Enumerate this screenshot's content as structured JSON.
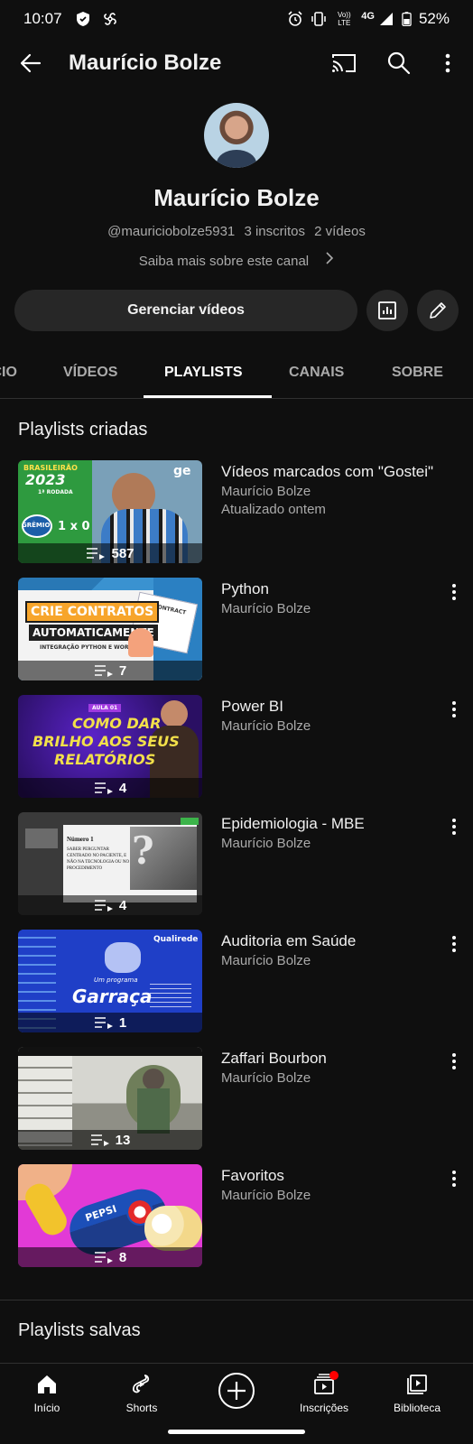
{
  "status_bar": {
    "time": "10:07",
    "network_label": "4G",
    "volte_label": "Vo)) LTE",
    "battery": "52%"
  },
  "app_bar": {
    "title": "Maurício Bolze"
  },
  "channel": {
    "name": "Maurício Bolze",
    "handle": "@mauriciobolze5931",
    "subscribers": "3 inscritos",
    "videos": "2 vídeos",
    "more_about": "Saiba mais sobre este canal",
    "manage_button": "Gerenciar vídeos"
  },
  "tabs": [
    {
      "label": "ÍCIO"
    },
    {
      "label": "VÍDEOS"
    },
    {
      "label": "PLAYLISTS"
    },
    {
      "label": "CANAIS"
    },
    {
      "label": "SOBRE"
    }
  ],
  "sections": {
    "created": "Playlists criadas",
    "saved": "Playlists salvas"
  },
  "playlists": [
    {
      "title": "Vídeos marcados com \"Gostei\"",
      "owner": "Maurício Bolze",
      "updated": "Atualizado ontem",
      "count": "587",
      "thumb_text": {
        "brand": "ge",
        "league": "BRASILEIRÃO",
        "year": "2023",
        "round": "1ª RODADA",
        "team": "GRÊMIO",
        "score": "1 x 0"
      }
    },
    {
      "title": "Python",
      "owner": "Maurício Bolze",
      "count": "7",
      "thumb_text": {
        "line1": "CRIE CONTRATOS",
        "line2": "AUTOMATICAMENTE",
        "line3": "INTEGRAÇÃO PYTHON E WORD",
        "doc": "CONTRACT"
      }
    },
    {
      "title": "Power BI",
      "owner": "Maurício Bolze",
      "count": "4",
      "thumb_text": {
        "badge": "AULA 01",
        "line1": "COMO DAR",
        "line2": "BRILHO AOS SEUS",
        "line3": "RELATÓRIOS"
      }
    },
    {
      "title": "Epidemiologia - MBE",
      "owner": "Maurício Bolze",
      "count": "4",
      "thumb_text": {
        "heading": "Número 1",
        "body": "SABER PERGUNTAR CENTRADO NO PACIENTE, E NÃO NA TECNOLOGIA OU NO PROCEDIMENTO"
      }
    },
    {
      "title": "Auditoria em Saúde",
      "owner": "Maurício Bolze",
      "count": "1",
      "thumb_text": {
        "brand": "Qualirede",
        "subtitle": "Um programa",
        "name": "Garraça"
      }
    },
    {
      "title": "Zaffari Bourbon",
      "owner": "Maurício Bolze",
      "count": "13"
    },
    {
      "title": "Favoritos",
      "owner": "Maurício Bolze",
      "count": "8",
      "thumb_text": {
        "brand": "PEPSI"
      }
    }
  ],
  "bottom_nav": [
    {
      "label": "Início",
      "icon": "home-icon"
    },
    {
      "label": "Shorts",
      "icon": "shorts-icon"
    },
    {
      "label": "",
      "icon": "create-icon"
    },
    {
      "label": "Inscrições",
      "icon": "subscriptions-icon"
    },
    {
      "label": "Biblioteca",
      "icon": "library-icon"
    }
  ],
  "colors": {
    "background": "#0f0f0f",
    "surface": "#272727",
    "secondary_text": "#aaaaaa",
    "notification": "#ff0000"
  }
}
